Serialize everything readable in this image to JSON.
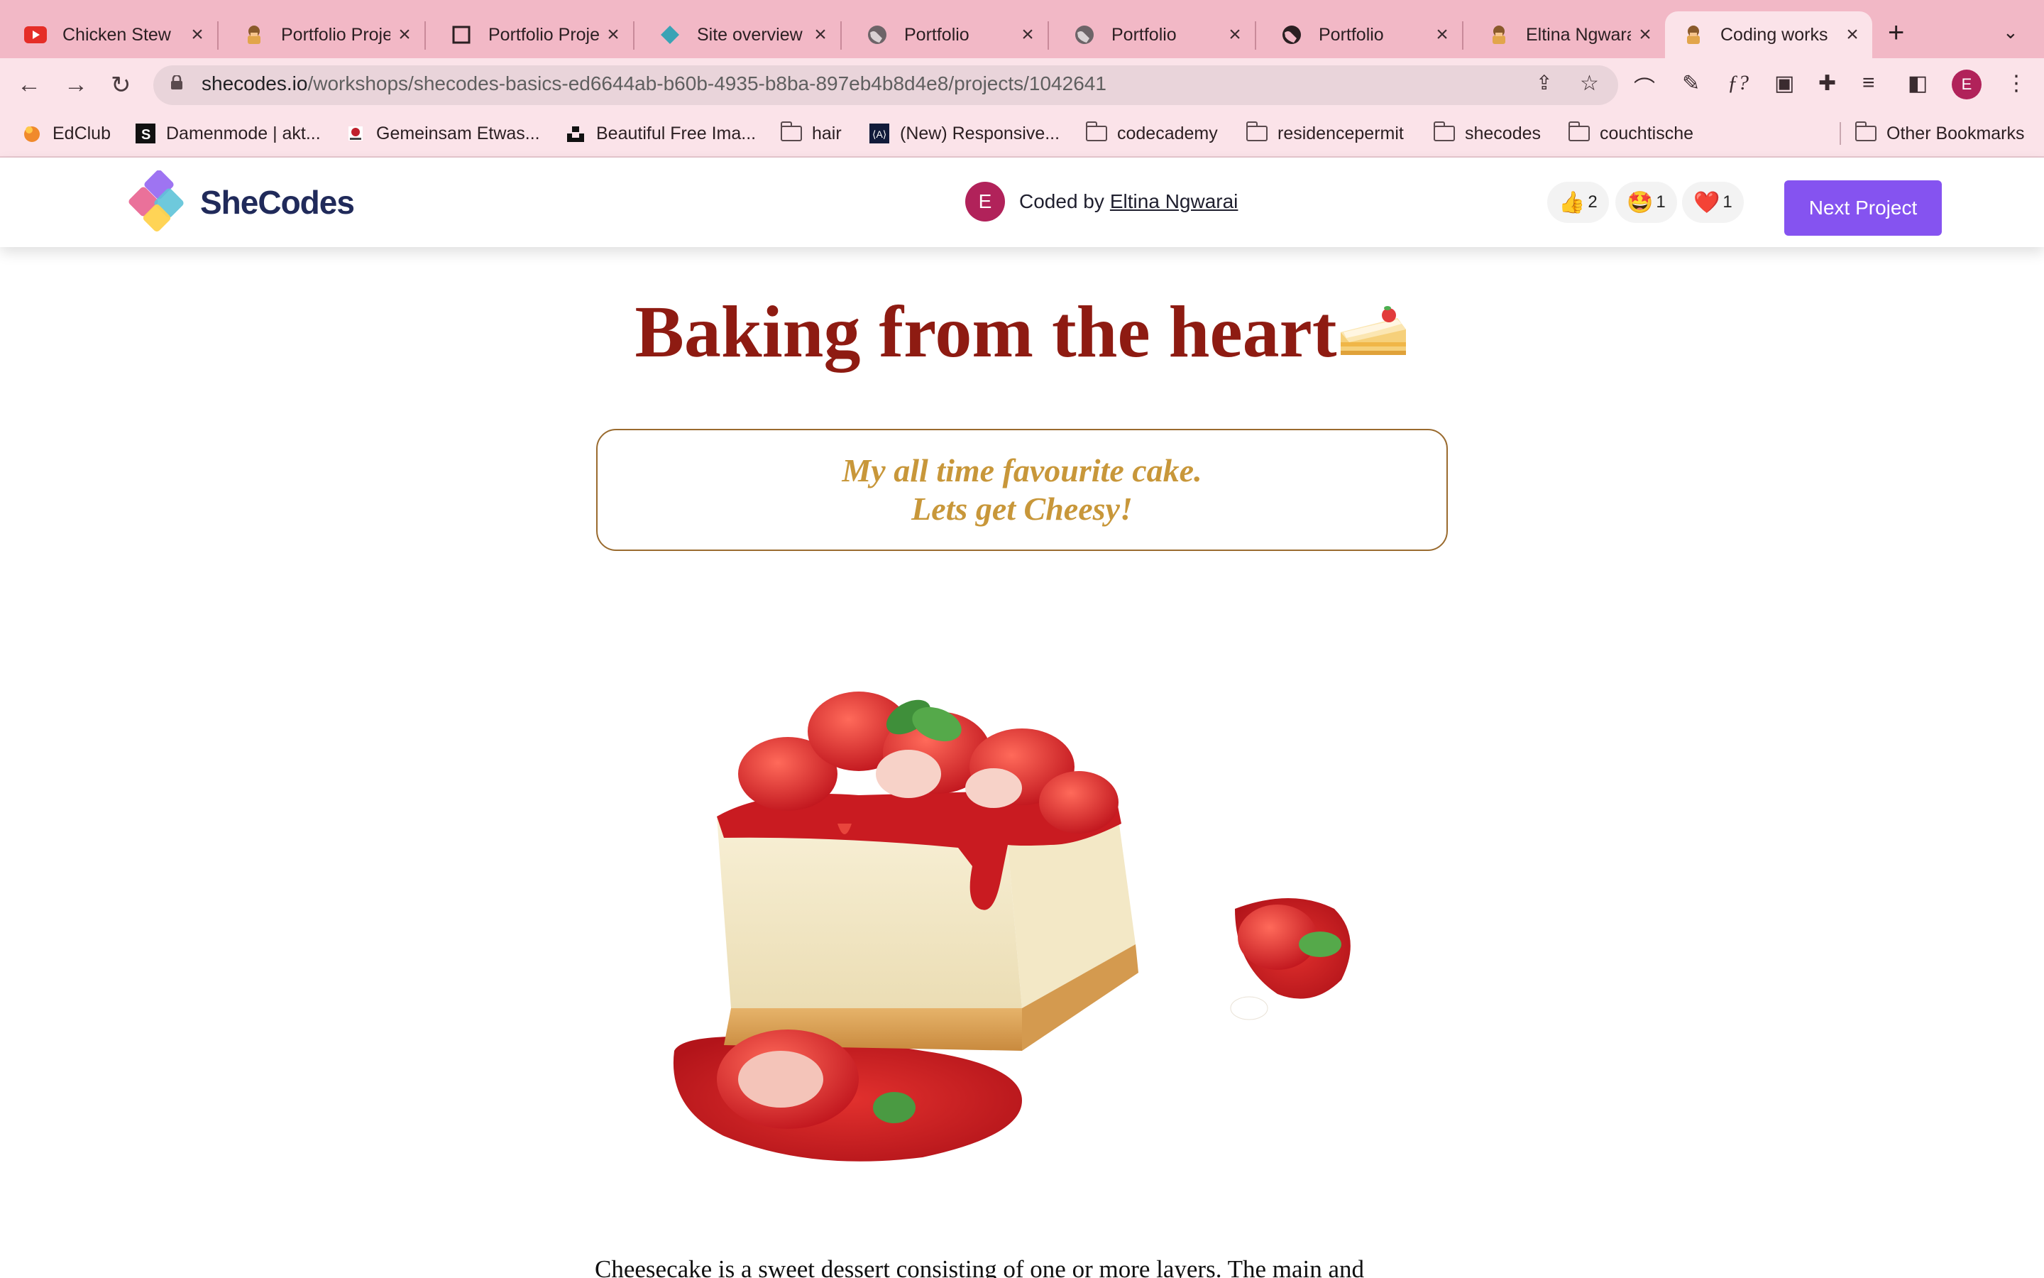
{
  "browser": {
    "tabs": [
      {
        "title": "Chicken Stew",
        "icon": "youtube-icon",
        "active": false
      },
      {
        "title": "Portfolio Proje",
        "icon": "shecodes-avatar-icon",
        "active": false
      },
      {
        "title": "Portfolio Proje",
        "icon": "square-outline-icon",
        "active": false
      },
      {
        "title": "Site overview",
        "icon": "netlify-diamond-icon",
        "active": false
      },
      {
        "title": "Portfolio",
        "icon": "globe-icon",
        "active": false
      },
      {
        "title": "Portfolio",
        "icon": "globe-icon",
        "active": false
      },
      {
        "title": "Portfolio",
        "icon": "globe-icon",
        "active": false
      },
      {
        "title": "Eltina Ngwarai",
        "icon": "shecodes-avatar-icon",
        "active": false
      },
      {
        "title": "Coding works",
        "icon": "shecodes-avatar-icon",
        "active": true
      }
    ],
    "url_host": "shecodes.io",
    "url_path": "/workshops/shecodes-basics-ed6644ab-b60b-4935-b8ba-897eb4b8d4e8/projects/1042641",
    "profile_initial": "E",
    "bookmarks": [
      {
        "label": "EdClub",
        "icon": "edclub-icon"
      },
      {
        "label": "Damenmode | akt...",
        "icon": "s-logo-icon"
      },
      {
        "label": "Gemeinsam Etwas...",
        "icon": "site-icon"
      },
      {
        "label": "Beautiful Free Ima...",
        "icon": "unsplash-icon"
      },
      {
        "label": "hair",
        "icon": "folder-icon"
      },
      {
        "label": "(New) Responsive...",
        "icon": "code-icon"
      },
      {
        "label": "codecademy",
        "icon": "folder-icon"
      },
      {
        "label": "residencepermit",
        "icon": "folder-icon"
      },
      {
        "label": "shecodes",
        "icon": "folder-icon"
      },
      {
        "label": "couchtische",
        "icon": "folder-icon"
      }
    ],
    "other_bookmarks": "Other Bookmarks"
  },
  "site_header": {
    "logo_text": "SheCodes",
    "author_initial": "E",
    "coded_by_prefix": "Coded by",
    "author_name": "Eltina Ngwarai",
    "reactions": [
      {
        "emoji": "👍",
        "count": "2"
      },
      {
        "emoji": "🤩",
        "count": "1"
      },
      {
        "emoji": "❤️",
        "count": "1"
      }
    ],
    "next_button": "Next Project"
  },
  "page": {
    "title": "Baking from the heart",
    "subtitle_line1": "My all time favourite cake.",
    "subtitle_line2": "Lets get Cheesy!",
    "image_subject": "strawberry cheesecake slice",
    "body_text": "Cheesecake is a sweet dessert consisting of one or more layers. The main and"
  },
  "colors": {
    "tab_bar": "#f2b8c6",
    "title": "#8e1b12",
    "subtitle": "#c8973a",
    "box_border": "#9a6b2f",
    "next_button": "#8553f0"
  }
}
